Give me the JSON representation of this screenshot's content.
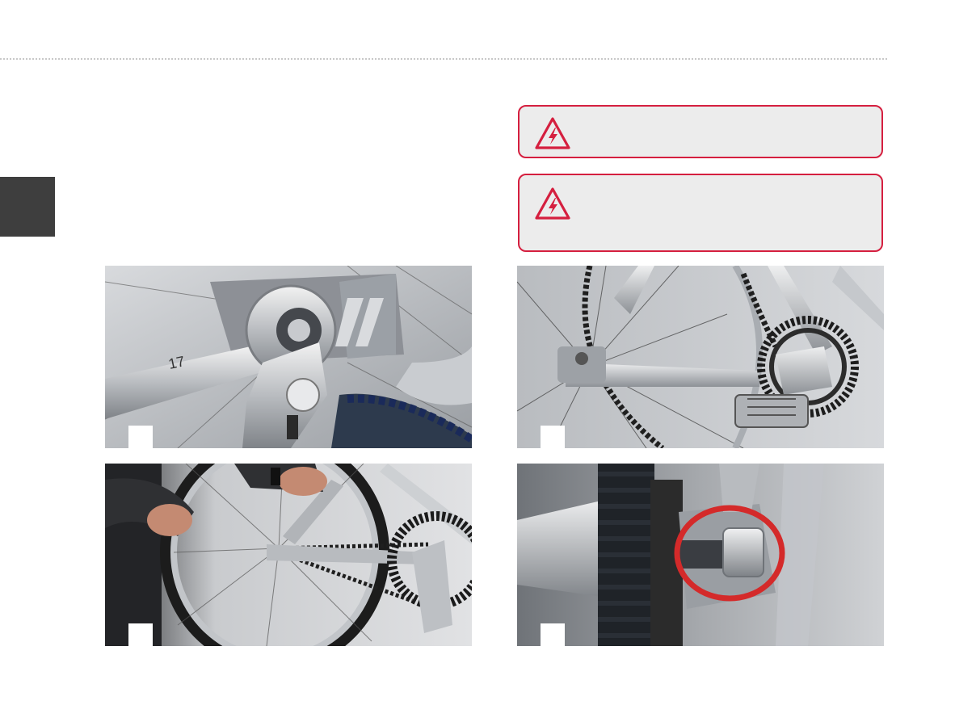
{
  "layout_marks": {
    "header_rule": "dotted",
    "section_tab_color": "#3e3e3e"
  },
  "warnings": [
    {
      "icon": "high-voltage-warning-icon",
      "border_color": "#d51f3f",
      "text": ""
    },
    {
      "icon": "high-voltage-warning-icon",
      "border_color": "#d51f3f",
      "text": ""
    }
  ],
  "photos": [
    {
      "subject": "wrench-and-ratchet-on-rear-axle-nut",
      "wrench_marking": "17",
      "step_label": ""
    },
    {
      "subject": "rear-wheel-with-belt-drive-and-crankset",
      "step_label": ""
    },
    {
      "subject": "hands-removing-rear-wheel",
      "step_label": ""
    },
    {
      "subject": "axle-nut-detail-circled",
      "highlight_color": "#d42a2a",
      "step_label": ""
    }
  ]
}
